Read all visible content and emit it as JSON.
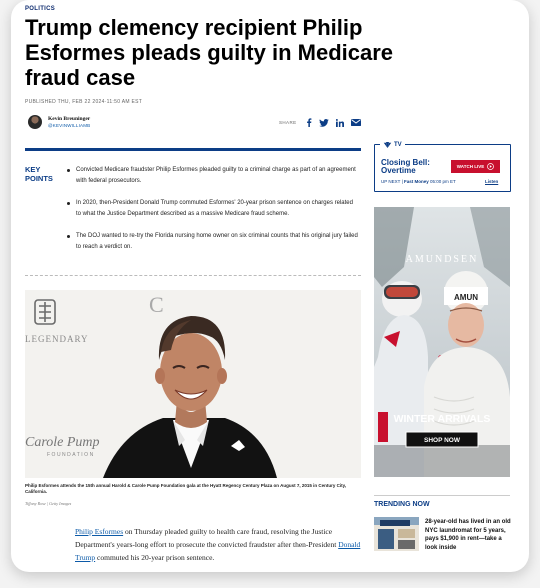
{
  "article": {
    "kicker": "POLITICS",
    "title": "Trump clemency recipient Philip Esformes pleads guilty in Medicare fraud case",
    "published": "PUBLISHED THU, FEB 22 2024·11:50 AM EST",
    "author": {
      "name": "Kevin Breuninger",
      "handle": "@KEVINWILLIAMB"
    },
    "share_label": "SHARE",
    "share_icons": [
      "facebook-icon",
      "twitter-icon",
      "linkedin-icon",
      "email-icon"
    ]
  },
  "key_points": {
    "label_line1": "KEY",
    "label_line2": "POINTS",
    "items": [
      "Convicted Medicare fraudster Philip Esformes pleaded guilty to a criminal charge as part of an agreement with federal prosecutors.",
      "In 2020, then-President Donald Trump commuted Esformes' 20-year prison sentence on charges related to what the Justice Department described as a massive Medicare fraud scheme.",
      "The DOJ wanted to re-try the Florida nursing home owner on six criminal counts that his original jury failed to reach a verdict on."
    ]
  },
  "photo": {
    "backdrop_text_1": "LEGENDARY",
    "backdrop_text_2": "Carole Pump",
    "backdrop_text_3": "FOUNDATION",
    "backdrop_text_4": "C",
    "caption": "Philip Esformes attends the 15th annual Harold & Carole Pump Foundation gala at the Hyatt Regency Century Plaza on August 7, 2015 in Century City, California.",
    "credit": "Tiffany Rose | Getty Images"
  },
  "body": {
    "link1": "Philip Esformes",
    "text1": " on Thursday pleaded guilty to health care fraud, resolving the Justice Department's years-long effort to prosecute the convicted fraudster after then-President ",
    "link2": "Donald Trump",
    "text2": " commuted his 20-year prison sentence."
  },
  "tv": {
    "logo": "TV",
    "show": "Closing Bell: Overtime",
    "watch_label": "WATCH LIVE",
    "up_next_prefix": "UP NEXT | ",
    "up_next_show": "Fast Money",
    "up_next_time": " 05:00 pm ET",
    "listen": "Listen"
  },
  "ad": {
    "brand": "AMUNDSEN",
    "hat_text": "AMUN",
    "headline": "WINTER ARRIVALS",
    "cta": "SHOP NOW"
  },
  "trending": {
    "title": "TRENDING NOW",
    "item": "28-year-old has lived in an old NYC laundromat for 5 years, pays $1,900 in rent—take a look inside"
  },
  "colors": {
    "accent": "#0c3d86",
    "live_red": "#c8102e",
    "link": "#0c5aa8"
  }
}
